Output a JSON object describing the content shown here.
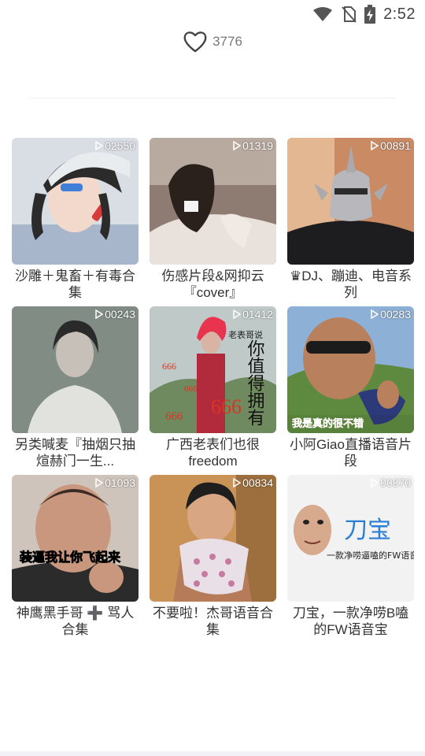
{
  "status_bar": {
    "time": "2:52",
    "icons": [
      "wifi-icon",
      "no-sim-icon",
      "battery-charging-icon"
    ]
  },
  "likes": {
    "icon": "heart-outline-icon",
    "count": "3776"
  },
  "items": [
    {
      "plays": "02550",
      "title": "沙雕＋鬼畜＋有毒合集"
    },
    {
      "plays": "01319",
      "title": "伤感片段&网抑云『cover』"
    },
    {
      "plays": "00891",
      "title": "♛DJ、蹦迪、电音系列"
    },
    {
      "plays": "00243",
      "title": "另类喊麦『抽烟只抽煊赫门一生..."
    },
    {
      "plays": "01412",
      "title": "广西老表们也很freedom",
      "overlay_text": [
        "老表哥说",
        "你值得拥有",
        "666",
        "666",
        "666",
        "666"
      ]
    },
    {
      "plays": "00283",
      "title": "小阿Giao直播语音片段",
      "overlay_text": [
        "我是真的很不错"
      ]
    },
    {
      "plays": "01093",
      "title": "神鹰黑手哥 ➕ 骂人合集",
      "overlay_text": [
        "装逼我让你飞起来"
      ]
    },
    {
      "plays": "00834",
      "title": "不要啦！杰哥语音合集"
    },
    {
      "plays": "00370",
      "title": "刀宝，一款净唠B嗑的FW语音宝",
      "overlay_text": [
        "刀宝",
        "一款净唠逼嗑的FW语音"
      ]
    }
  ],
  "colors": {
    "accent_blue": "#2a7fd4",
    "text": "#333333",
    "muted": "#777777"
  }
}
